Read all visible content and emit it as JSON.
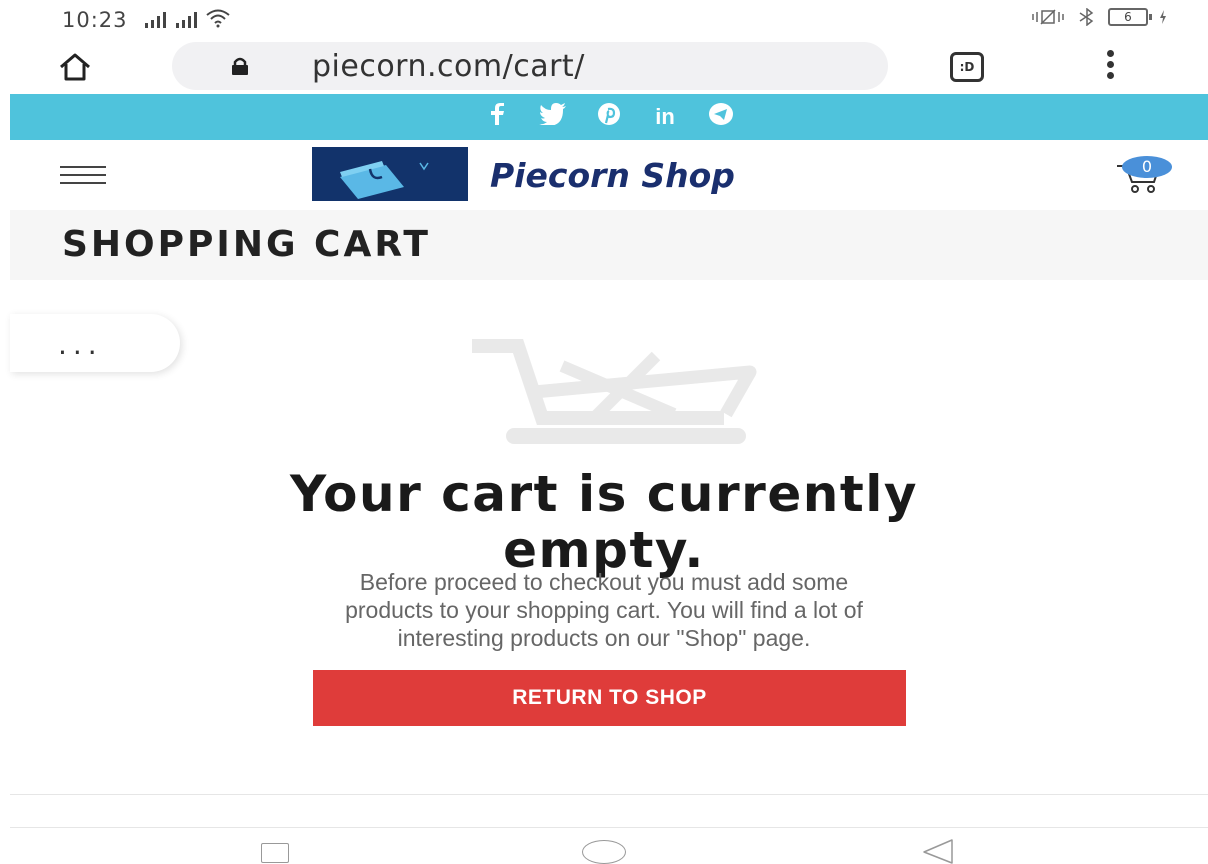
{
  "status_bar": {
    "time": "10:23",
    "battery": "6"
  },
  "browser": {
    "url": "piecorn.com/cart/",
    "tab_label": ":D"
  },
  "social": [
    "f",
    "t",
    "p",
    "in",
    "tg"
  ],
  "header": {
    "logo_text": "Piecorn Shop",
    "cart_count": "0"
  },
  "page": {
    "title": "SHOPPING CART",
    "more_label": "..."
  },
  "empty_cart": {
    "heading_line1": "Your cart is currently",
    "heading_line2": "empty.",
    "description_line1": "Before proceed to checkout you must add some",
    "description_line2": "products to your shopping cart. You will find a lot of",
    "description_line3": "interesting products on our \"Shop\" page.",
    "button_label": "RETURN TO SHOP"
  },
  "colors": {
    "social_bar": "#4fc3dc",
    "button": "#df3c3a",
    "logo_bg": "#12336b",
    "badge": "#4a90d9"
  }
}
